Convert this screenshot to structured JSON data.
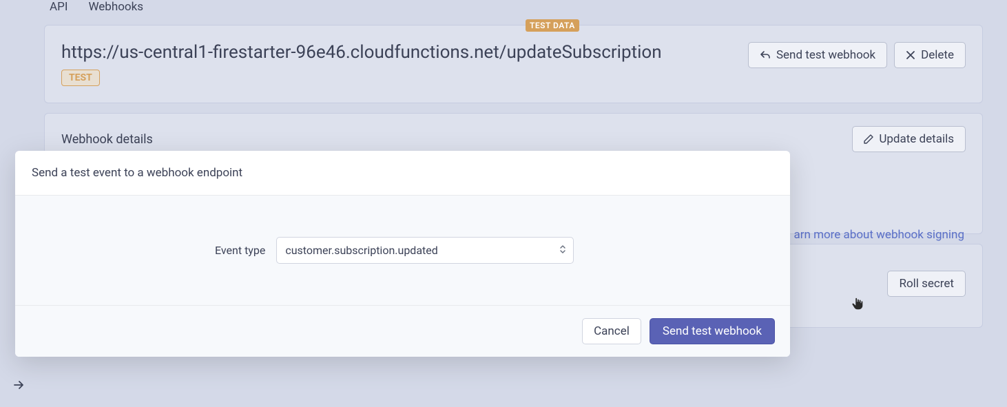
{
  "tabs": {
    "api": "API",
    "webhooks": "Webhooks"
  },
  "header": {
    "test_data_badge": "TEST DATA",
    "url": "https://us-central1-firestarter-96e46.cloudfunctions.net/updateSubscription",
    "test_badge": "TEST",
    "send_test_label": "Send test webhook",
    "delete_label": "Delete"
  },
  "details": {
    "title": "Webhook details",
    "update_label": "Update details"
  },
  "signing": {
    "learn_more": "arn more about webhook signing",
    "roll_secret_label": "Roll secret"
  },
  "modal": {
    "title": "Send a test event to a webhook endpoint",
    "field_label": "Event type",
    "selected_value": "customer.subscription.updated",
    "cancel_label": "Cancel",
    "submit_label": "Send test webhook"
  }
}
